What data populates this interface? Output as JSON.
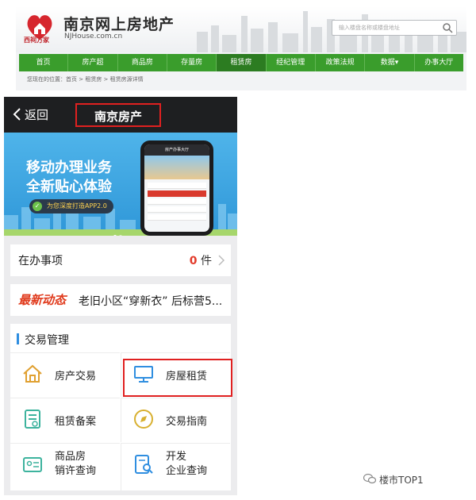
{
  "site": {
    "logo_tag": "西祠方家",
    "title": "南京网上房地产",
    "url": "NJHouse.com.cn",
    "search_placeholder": "输入楼盘名称或楼盘地址",
    "nav": [
      "首页",
      "房产超",
      "商品房",
      "存量房",
      "租赁房",
      "经纪管理",
      "政策法规",
      "数据▾",
      "办事大厅"
    ],
    "active_nav_index": 4,
    "breadcrumb": "您现在的位置：首页 > 租赁房 > 租赁房源详情"
  },
  "phone": {
    "back_label": "返回",
    "title": "南京房产",
    "banner": {
      "line1": "移动办理业务",
      "line2": "全新贴心体验",
      "pill": "为您深度打造APP2.0",
      "mock_header": "房产办事大厅"
    },
    "pending": {
      "label": "在办事项",
      "count": "0",
      "unit": "件"
    },
    "news": {
      "tag": "最新动态",
      "text": "老旧小区“穿新衣” 后标营5..."
    },
    "trade": {
      "title": "交易管理",
      "items": [
        {
          "label": "房产交易",
          "icon": "house-icon"
        },
        {
          "label": "房屋租赁",
          "icon": "monitor-icon"
        },
        {
          "label": "租赁备案",
          "icon": "document-icon"
        },
        {
          "label": "交易指南",
          "icon": "compass-icon"
        },
        {
          "label_line1": "商品房",
          "label_line2": "销许查询",
          "icon": "id-card-icon"
        },
        {
          "label_line1": "开发",
          "label_line2": "企业查询",
          "icon": "search-doc-icon"
        }
      ]
    }
  },
  "watermark": "楼市TOP1",
  "colors": {
    "nav_green": "#3a9d2c",
    "highlight_red": "#e02020",
    "banner_blue": "#2f97d8",
    "header_dark": "#1e1f21"
  }
}
